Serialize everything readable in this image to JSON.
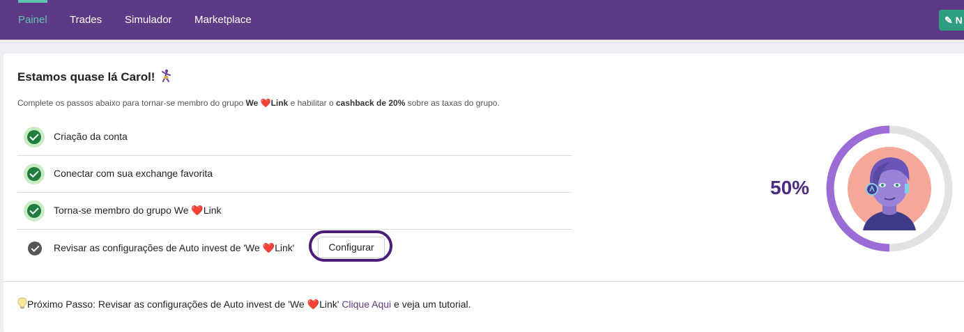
{
  "nav": {
    "tabs": [
      {
        "label": "Painel",
        "active": true
      },
      {
        "label": "Trades",
        "active": false
      },
      {
        "label": "Simulador",
        "active": false
      },
      {
        "label": "Marketplace",
        "active": false
      }
    ],
    "new_button_label": "N",
    "new_button_icon": "magic-wand-icon"
  },
  "onboarding": {
    "title": "Estamos quase lá Carol!",
    "title_icon": "dancer-emoji",
    "subtitle_before": "Complete os passos abaixo para tornar-se membro do grupo ",
    "subtitle_group_we": "We ",
    "subtitle_heart": "❤️",
    "subtitle_group_link": "Link",
    "subtitle_middle": " e habilitar o ",
    "subtitle_cashback": "cashback de 20%",
    "subtitle_after": " sobre as taxas do grupo.",
    "steps": [
      {
        "label": "Criação da conta",
        "done": true
      },
      {
        "label": "Conectar com sua exchange favorita",
        "done": true
      },
      {
        "label_before": "Torna-se membro do grupo We ",
        "heart": "❤️",
        "label_after": "Link",
        "done": true
      },
      {
        "label_before": "Revisar as configurações de Auto invest de 'We ",
        "heart": "❤️",
        "label_after": "Link'",
        "done": false
      }
    ],
    "configure_button": "Configurar",
    "next_step": {
      "icon": "lightbulb-icon",
      "text_before": "Próximo Passo: Revisar as configurações de Auto invest de 'We ",
      "heart": "❤️",
      "text_after": "Link' ",
      "link": "Clique Aqui",
      "text_end": " e veja um tutorial."
    },
    "progress": {
      "percent_label": "50%",
      "value": 0.5
    },
    "colors": {
      "nav_bg": "#5e3a86",
      "active_tab": "#5ec3b0",
      "check_green": "#1f7d3e",
      "progress_purple": "#9b6bd6",
      "progress_track": "#e2e2e2",
      "percent_text": "#4b2a82",
      "avatar_bg": "#f5a89a"
    }
  }
}
